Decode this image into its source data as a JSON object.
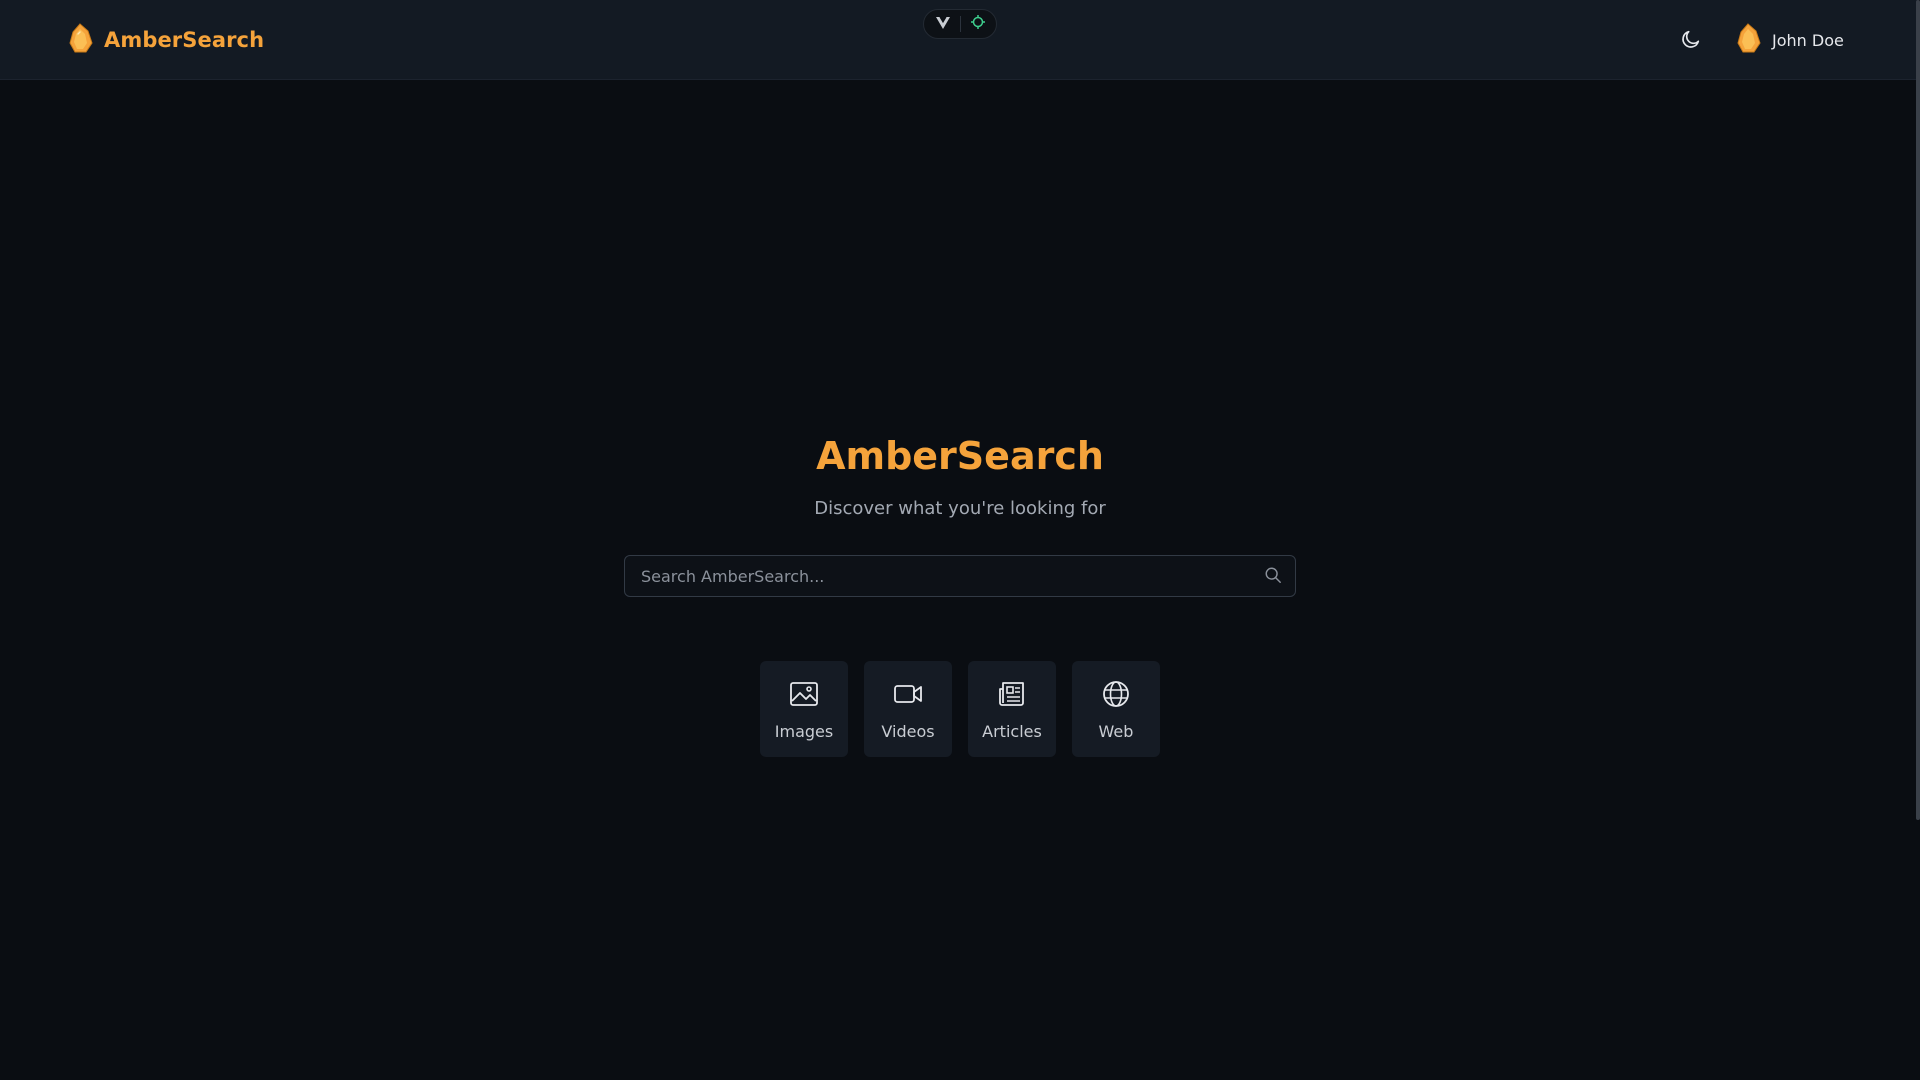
{
  "header": {
    "brand_name": "AmberSearch",
    "user_name": "John Doe",
    "theme_icon": "moon-icon",
    "devtools_icons": [
      "vue-devtools-icon",
      "inspector-icon"
    ]
  },
  "hero": {
    "title": "AmberSearch",
    "subtitle": "Discover what you're looking for"
  },
  "search": {
    "placeholder": "Search AmberSearch...",
    "value": "",
    "icon": "search-icon"
  },
  "categories": [
    {
      "label": "Images",
      "icon": "image-icon"
    },
    {
      "label": "Videos",
      "icon": "video-icon"
    },
    {
      "label": "Articles",
      "icon": "newspaper-icon"
    },
    {
      "label": "Web",
      "icon": "globe-icon"
    }
  ],
  "colors": {
    "accent": "#f5a33b",
    "background": "#0a0d12",
    "header": "#131a23",
    "card": "#151b24",
    "devtools_green": "#3ecf8e"
  }
}
